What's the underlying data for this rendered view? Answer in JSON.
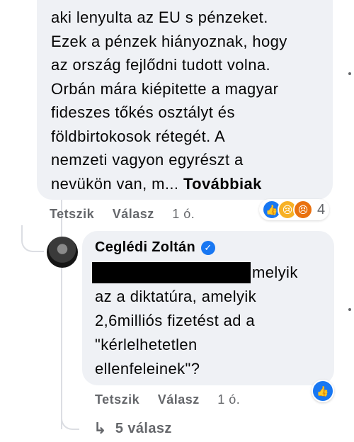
{
  "comment1": {
    "text": "aki lenyulta az EU s pénzeket.\nEzek a pénzek hiányoznak, hogy\naz ország fejlődni tudott volna.\nOrbán mára kiépitette a magyar\nfideszes tőkés osztályt és\nföldbirtokosok rétegét. A\nnemzeti vagyon egyrészt a\nnevükön van, m...",
    "more_label": "Továbbiak",
    "like_label": "Tetszik",
    "reply_label": "Válasz",
    "time": "1 ó.",
    "reaction_count": "4",
    "reaction_icons": [
      "like-icon",
      "sad-icon",
      "angry-icon"
    ]
  },
  "reply": {
    "author": "Ceglédi Zoltán",
    "text_first_line_end": "melyik",
    "text": "az a diktatúra, amelyik\n2,6milliós fizetést ad a\n\"kérlelhetetlen\nellenfeleinek\"?",
    "like_label": "Tetszik",
    "reply_label": "Válasz",
    "time": "1 ó."
  },
  "more_replies": {
    "label": "5 válasz"
  },
  "colors": {
    "bubble": "#eff1f5",
    "muted": "#65676b",
    "accent": "#1877f2"
  }
}
